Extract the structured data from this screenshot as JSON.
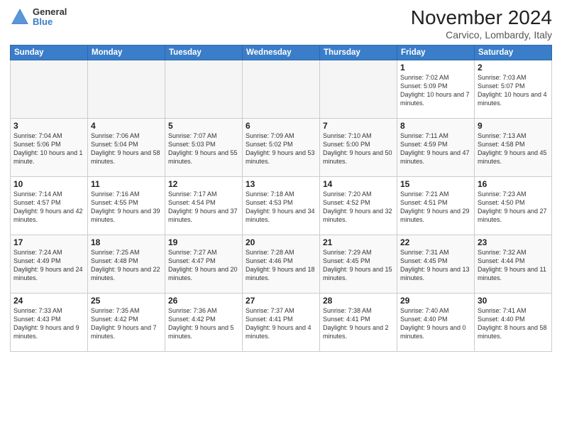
{
  "logo": {
    "general": "General",
    "blue": "Blue"
  },
  "header": {
    "month": "November 2024",
    "location": "Carvico, Lombardy, Italy"
  },
  "weekdays": [
    "Sunday",
    "Monday",
    "Tuesday",
    "Wednesday",
    "Thursday",
    "Friday",
    "Saturday"
  ],
  "weeks": [
    [
      {
        "day": "",
        "info": ""
      },
      {
        "day": "",
        "info": ""
      },
      {
        "day": "",
        "info": ""
      },
      {
        "day": "",
        "info": ""
      },
      {
        "day": "",
        "info": ""
      },
      {
        "day": "1",
        "info": "Sunrise: 7:02 AM\nSunset: 5:09 PM\nDaylight: 10 hours\nand 7 minutes."
      },
      {
        "day": "2",
        "info": "Sunrise: 7:03 AM\nSunset: 5:07 PM\nDaylight: 10 hours\nand 4 minutes."
      }
    ],
    [
      {
        "day": "3",
        "info": "Sunrise: 7:04 AM\nSunset: 5:06 PM\nDaylight: 10 hours\nand 1 minute."
      },
      {
        "day": "4",
        "info": "Sunrise: 7:06 AM\nSunset: 5:04 PM\nDaylight: 9 hours\nand 58 minutes."
      },
      {
        "day": "5",
        "info": "Sunrise: 7:07 AM\nSunset: 5:03 PM\nDaylight: 9 hours\nand 55 minutes."
      },
      {
        "day": "6",
        "info": "Sunrise: 7:09 AM\nSunset: 5:02 PM\nDaylight: 9 hours\nand 53 minutes."
      },
      {
        "day": "7",
        "info": "Sunrise: 7:10 AM\nSunset: 5:00 PM\nDaylight: 9 hours\nand 50 minutes."
      },
      {
        "day": "8",
        "info": "Sunrise: 7:11 AM\nSunset: 4:59 PM\nDaylight: 9 hours\nand 47 minutes."
      },
      {
        "day": "9",
        "info": "Sunrise: 7:13 AM\nSunset: 4:58 PM\nDaylight: 9 hours\nand 45 minutes."
      }
    ],
    [
      {
        "day": "10",
        "info": "Sunrise: 7:14 AM\nSunset: 4:57 PM\nDaylight: 9 hours\nand 42 minutes."
      },
      {
        "day": "11",
        "info": "Sunrise: 7:16 AM\nSunset: 4:55 PM\nDaylight: 9 hours\nand 39 minutes."
      },
      {
        "day": "12",
        "info": "Sunrise: 7:17 AM\nSunset: 4:54 PM\nDaylight: 9 hours\nand 37 minutes."
      },
      {
        "day": "13",
        "info": "Sunrise: 7:18 AM\nSunset: 4:53 PM\nDaylight: 9 hours\nand 34 minutes."
      },
      {
        "day": "14",
        "info": "Sunrise: 7:20 AM\nSunset: 4:52 PM\nDaylight: 9 hours\nand 32 minutes."
      },
      {
        "day": "15",
        "info": "Sunrise: 7:21 AM\nSunset: 4:51 PM\nDaylight: 9 hours\nand 29 minutes."
      },
      {
        "day": "16",
        "info": "Sunrise: 7:23 AM\nSunset: 4:50 PM\nDaylight: 9 hours\nand 27 minutes."
      }
    ],
    [
      {
        "day": "17",
        "info": "Sunrise: 7:24 AM\nSunset: 4:49 PM\nDaylight: 9 hours\nand 24 minutes."
      },
      {
        "day": "18",
        "info": "Sunrise: 7:25 AM\nSunset: 4:48 PM\nDaylight: 9 hours\nand 22 minutes."
      },
      {
        "day": "19",
        "info": "Sunrise: 7:27 AM\nSunset: 4:47 PM\nDaylight: 9 hours\nand 20 minutes."
      },
      {
        "day": "20",
        "info": "Sunrise: 7:28 AM\nSunset: 4:46 PM\nDaylight: 9 hours\nand 18 minutes."
      },
      {
        "day": "21",
        "info": "Sunrise: 7:29 AM\nSunset: 4:45 PM\nDaylight: 9 hours\nand 15 minutes."
      },
      {
        "day": "22",
        "info": "Sunrise: 7:31 AM\nSunset: 4:45 PM\nDaylight: 9 hours\nand 13 minutes."
      },
      {
        "day": "23",
        "info": "Sunrise: 7:32 AM\nSunset: 4:44 PM\nDaylight: 9 hours\nand 11 minutes."
      }
    ],
    [
      {
        "day": "24",
        "info": "Sunrise: 7:33 AM\nSunset: 4:43 PM\nDaylight: 9 hours\nand 9 minutes."
      },
      {
        "day": "25",
        "info": "Sunrise: 7:35 AM\nSunset: 4:42 PM\nDaylight: 9 hours\nand 7 minutes."
      },
      {
        "day": "26",
        "info": "Sunrise: 7:36 AM\nSunset: 4:42 PM\nDaylight: 9 hours\nand 5 minutes."
      },
      {
        "day": "27",
        "info": "Sunrise: 7:37 AM\nSunset: 4:41 PM\nDaylight: 9 hours\nand 4 minutes."
      },
      {
        "day": "28",
        "info": "Sunrise: 7:38 AM\nSunset: 4:41 PM\nDaylight: 9 hours\nand 2 minutes."
      },
      {
        "day": "29",
        "info": "Sunrise: 7:40 AM\nSunset: 4:40 PM\nDaylight: 9 hours\nand 0 minutes."
      },
      {
        "day": "30",
        "info": "Sunrise: 7:41 AM\nSunset: 4:40 PM\nDaylight: 8 hours\nand 58 minutes."
      }
    ]
  ]
}
